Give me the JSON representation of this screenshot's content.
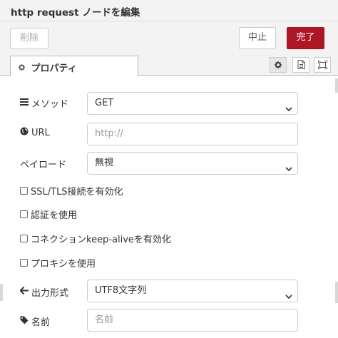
{
  "header": {
    "title": "http request ノードを編集"
  },
  "toolbar": {
    "delete_label": "削除",
    "cancel_label": "中止",
    "done_label": "完了"
  },
  "tabs": {
    "properties_label": "プロパティ"
  },
  "icons": {
    "settings": "gear-icon",
    "description": "document-icon",
    "appearance": "frame-icon"
  },
  "form": {
    "method": {
      "label": "メソッド",
      "value": "GET"
    },
    "url": {
      "label": "URL",
      "value": "",
      "placeholder": "http://"
    },
    "payload": {
      "label": "ペイロード",
      "value": "無視"
    },
    "options": {
      "ssl": "SSL/TLS接続を有効化",
      "auth": "認証を使用",
      "keepalive": "コネクションkeep-aliveを有効化",
      "proxy": "プロキシを使用"
    },
    "output": {
      "label": "出力形式",
      "value": "UTF8文字列"
    },
    "name": {
      "label": "名前",
      "value": "",
      "placeholder": "名前"
    }
  },
  "colors": {
    "primary": "#ad1625",
    "panel": "#f3f3f3",
    "border": "#cccccc"
  }
}
